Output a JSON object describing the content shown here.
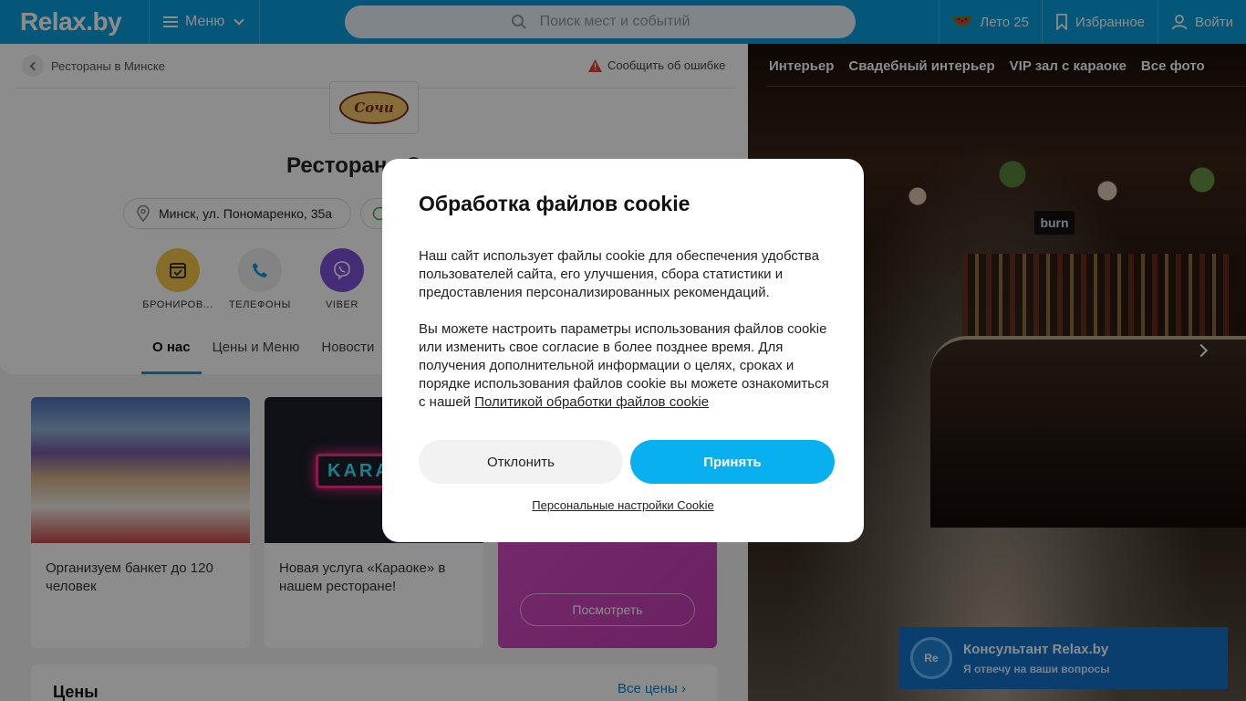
{
  "header": {
    "logo": "Relax.by",
    "menu_label": "Меню",
    "search_placeholder": "Поиск мест и событий",
    "summer_label": "Лето 25",
    "favorites_label": "Избранное",
    "login_label": "Войти"
  },
  "page": {
    "breadcrumb": "Рестораны в Минске",
    "report_label": "Сообщить об ошибке",
    "logo_text": "Сочи",
    "title": "Ресторан «Сочи»",
    "address": "Минск, ул. Пономаренко, 35а",
    "actions": [
      {
        "label": "БРОНИРОВ..."
      },
      {
        "label": "ТЕЛЕФОНЫ"
      },
      {
        "label": "VIBER"
      }
    ],
    "tabs": [
      "О нас",
      "Цены и Меню",
      "Новости"
    ]
  },
  "promos": [
    {
      "text": "Организуем банкет до 120 человек"
    },
    {
      "text": "Новая услуга «Караоке» в нашем ресторане!",
      "neon": "KARA"
    },
    {
      "button": "Посмотреть"
    }
  ],
  "prices": {
    "heading": "Цены",
    "all_link": "Все цены"
  },
  "photo": {
    "tabs": [
      "Интерьер",
      "Свадебный интерьер",
      "VIP зал с караоке",
      "Все фото"
    ],
    "sign": "burn"
  },
  "consultant": {
    "avatar": "Re",
    "title": "Консультант Relax.by",
    "subtitle": "Я отвечу на ваши вопросы"
  },
  "cookie_modal": {
    "title": "Обработка файлов cookie",
    "paragraph1": "Наш сайт использует файлы cookie для обеспечения удобства пользователей сайта, его улучшения, сбора статистики и предоставления персонализированных рекомендаций.",
    "paragraph2": "Вы можете настроить параметры использования файлов cookie или изменить свое согласие в более позднее время. Для получения дополнительной информации о целях, сроках и порядке использования файлов cookie вы можете ознакомиться с нашей",
    "policy_link": "Политикой обработки файлов cookie",
    "decline": "Отклонить",
    "accept": "Принять",
    "personal_settings": "Персональные настройки Cookie"
  },
  "colors": {
    "brand": "#0a9fdf",
    "accept": "#08b0f0",
    "consultant": "#1172c9",
    "booking_circle": "#f6c74a",
    "viber_circle": "#7c51d8"
  }
}
